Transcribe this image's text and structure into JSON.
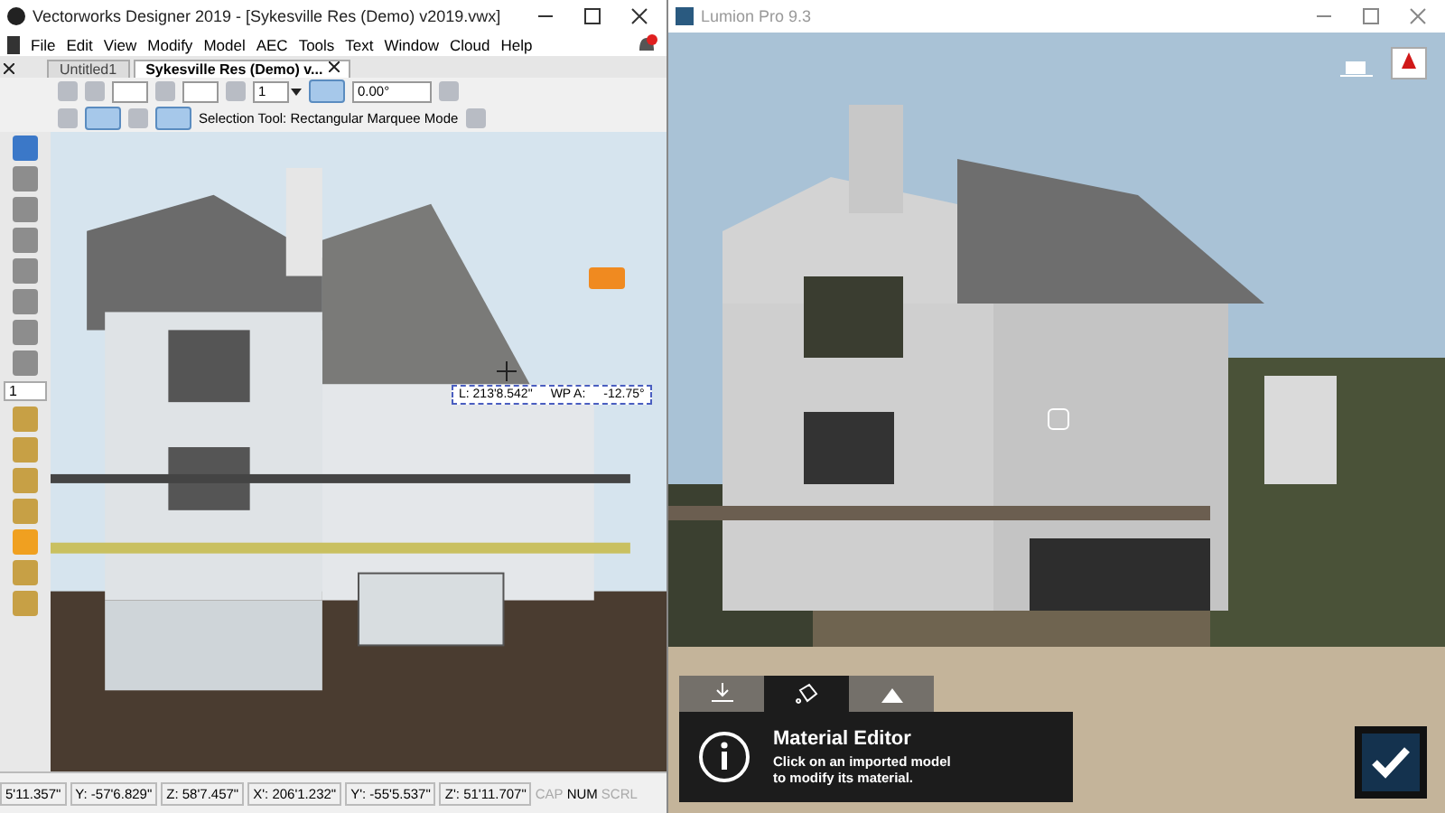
{
  "vectorworks": {
    "title": "Vectorworks Designer 2019 - [Sykesville Res (Demo) v2019.vwx]",
    "menu": [
      "File",
      "Edit",
      "View",
      "Modify",
      "Model",
      "AEC",
      "Tools",
      "Text",
      "Window",
      "Cloud",
      "Help"
    ],
    "tabs": [
      {
        "label": "Untitled1",
        "selected": false
      },
      {
        "label": "Sykesville Res (Demo) v...",
        "selected": true
      }
    ],
    "toolbar": {
      "zoom": "1",
      "angle": "0.00°",
      "mode_label": "Selection Tool: Rectangular Marquee Mode"
    },
    "palette_header": "1",
    "tools": [
      {
        "selected": true
      },
      {
        "selected": false
      },
      {
        "selected": false
      },
      {
        "selected": false
      },
      {
        "selected": false
      },
      {
        "selected": false
      },
      {
        "selected": false
      },
      {
        "selected": false
      }
    ],
    "tools2": [
      {
        "selected": false
      },
      {
        "selected": false
      },
      {
        "selected": false
      },
      {
        "selected": false
      },
      {
        "selected": true
      },
      {
        "selected": false
      },
      {
        "selected": false
      }
    ],
    "dimension_tip": {
      "length": "L:   213'8.542\"",
      "wp_label": "WP A:",
      "wp_angle": "-12.75°"
    },
    "status": [
      {
        "text": "5'11.357\""
      },
      {
        "text": "Y: -57'6.829\""
      },
      {
        "text": "Z: 58'7.457\""
      },
      {
        "text": "X': 206'1.232\""
      },
      {
        "text": "Y': -55'5.537\""
      },
      {
        "text": "Z': 51'11.707\""
      }
    ],
    "indicators": [
      {
        "label": "CAP",
        "on": false
      },
      {
        "label": "NUM",
        "on": true
      },
      {
        "label": "SCRL",
        "on": false
      }
    ]
  },
  "lumion": {
    "title": "Lumion Pro 9.3",
    "mode_tabs": [
      {
        "selected": false
      },
      {
        "selected": true
      },
      {
        "selected": false
      }
    ],
    "info": {
      "title": "Material Editor",
      "text": "Click on an imported model to modify its material."
    }
  }
}
